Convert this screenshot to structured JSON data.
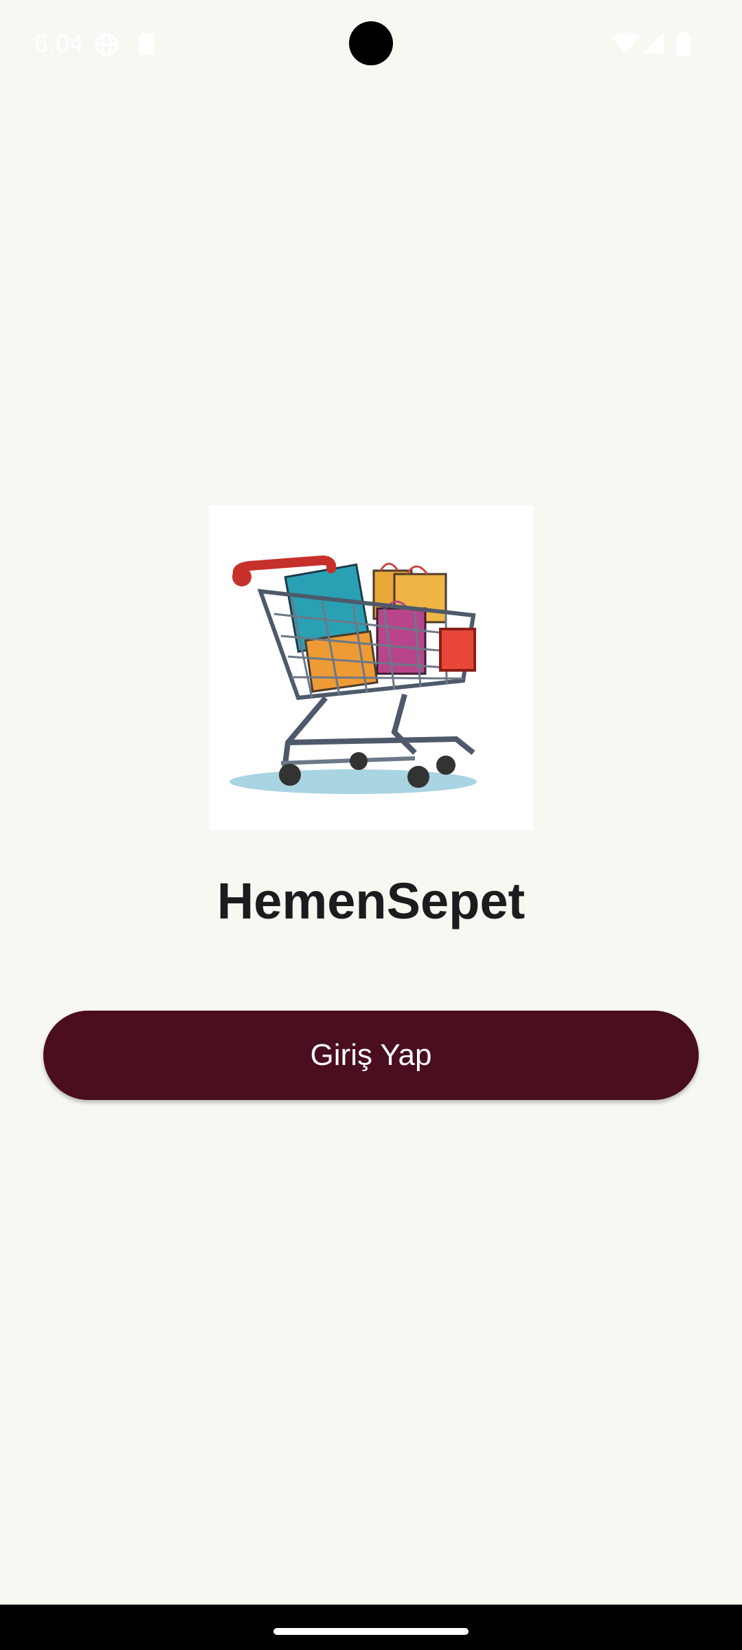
{
  "status_bar": {
    "time": "6:04",
    "icons": [
      "vpn-globe-icon",
      "sim-card-icon",
      "wifi-icon",
      "signal-icon",
      "battery-icon"
    ]
  },
  "main": {
    "logo": {
      "icon": "shopping-cart-icon"
    },
    "app_title": "HemenSepet",
    "login_button_label": "Giriş Yap"
  },
  "colors": {
    "background": "#f8f8f3",
    "button": "#4a0e1e",
    "title": "#1d1b1e"
  }
}
